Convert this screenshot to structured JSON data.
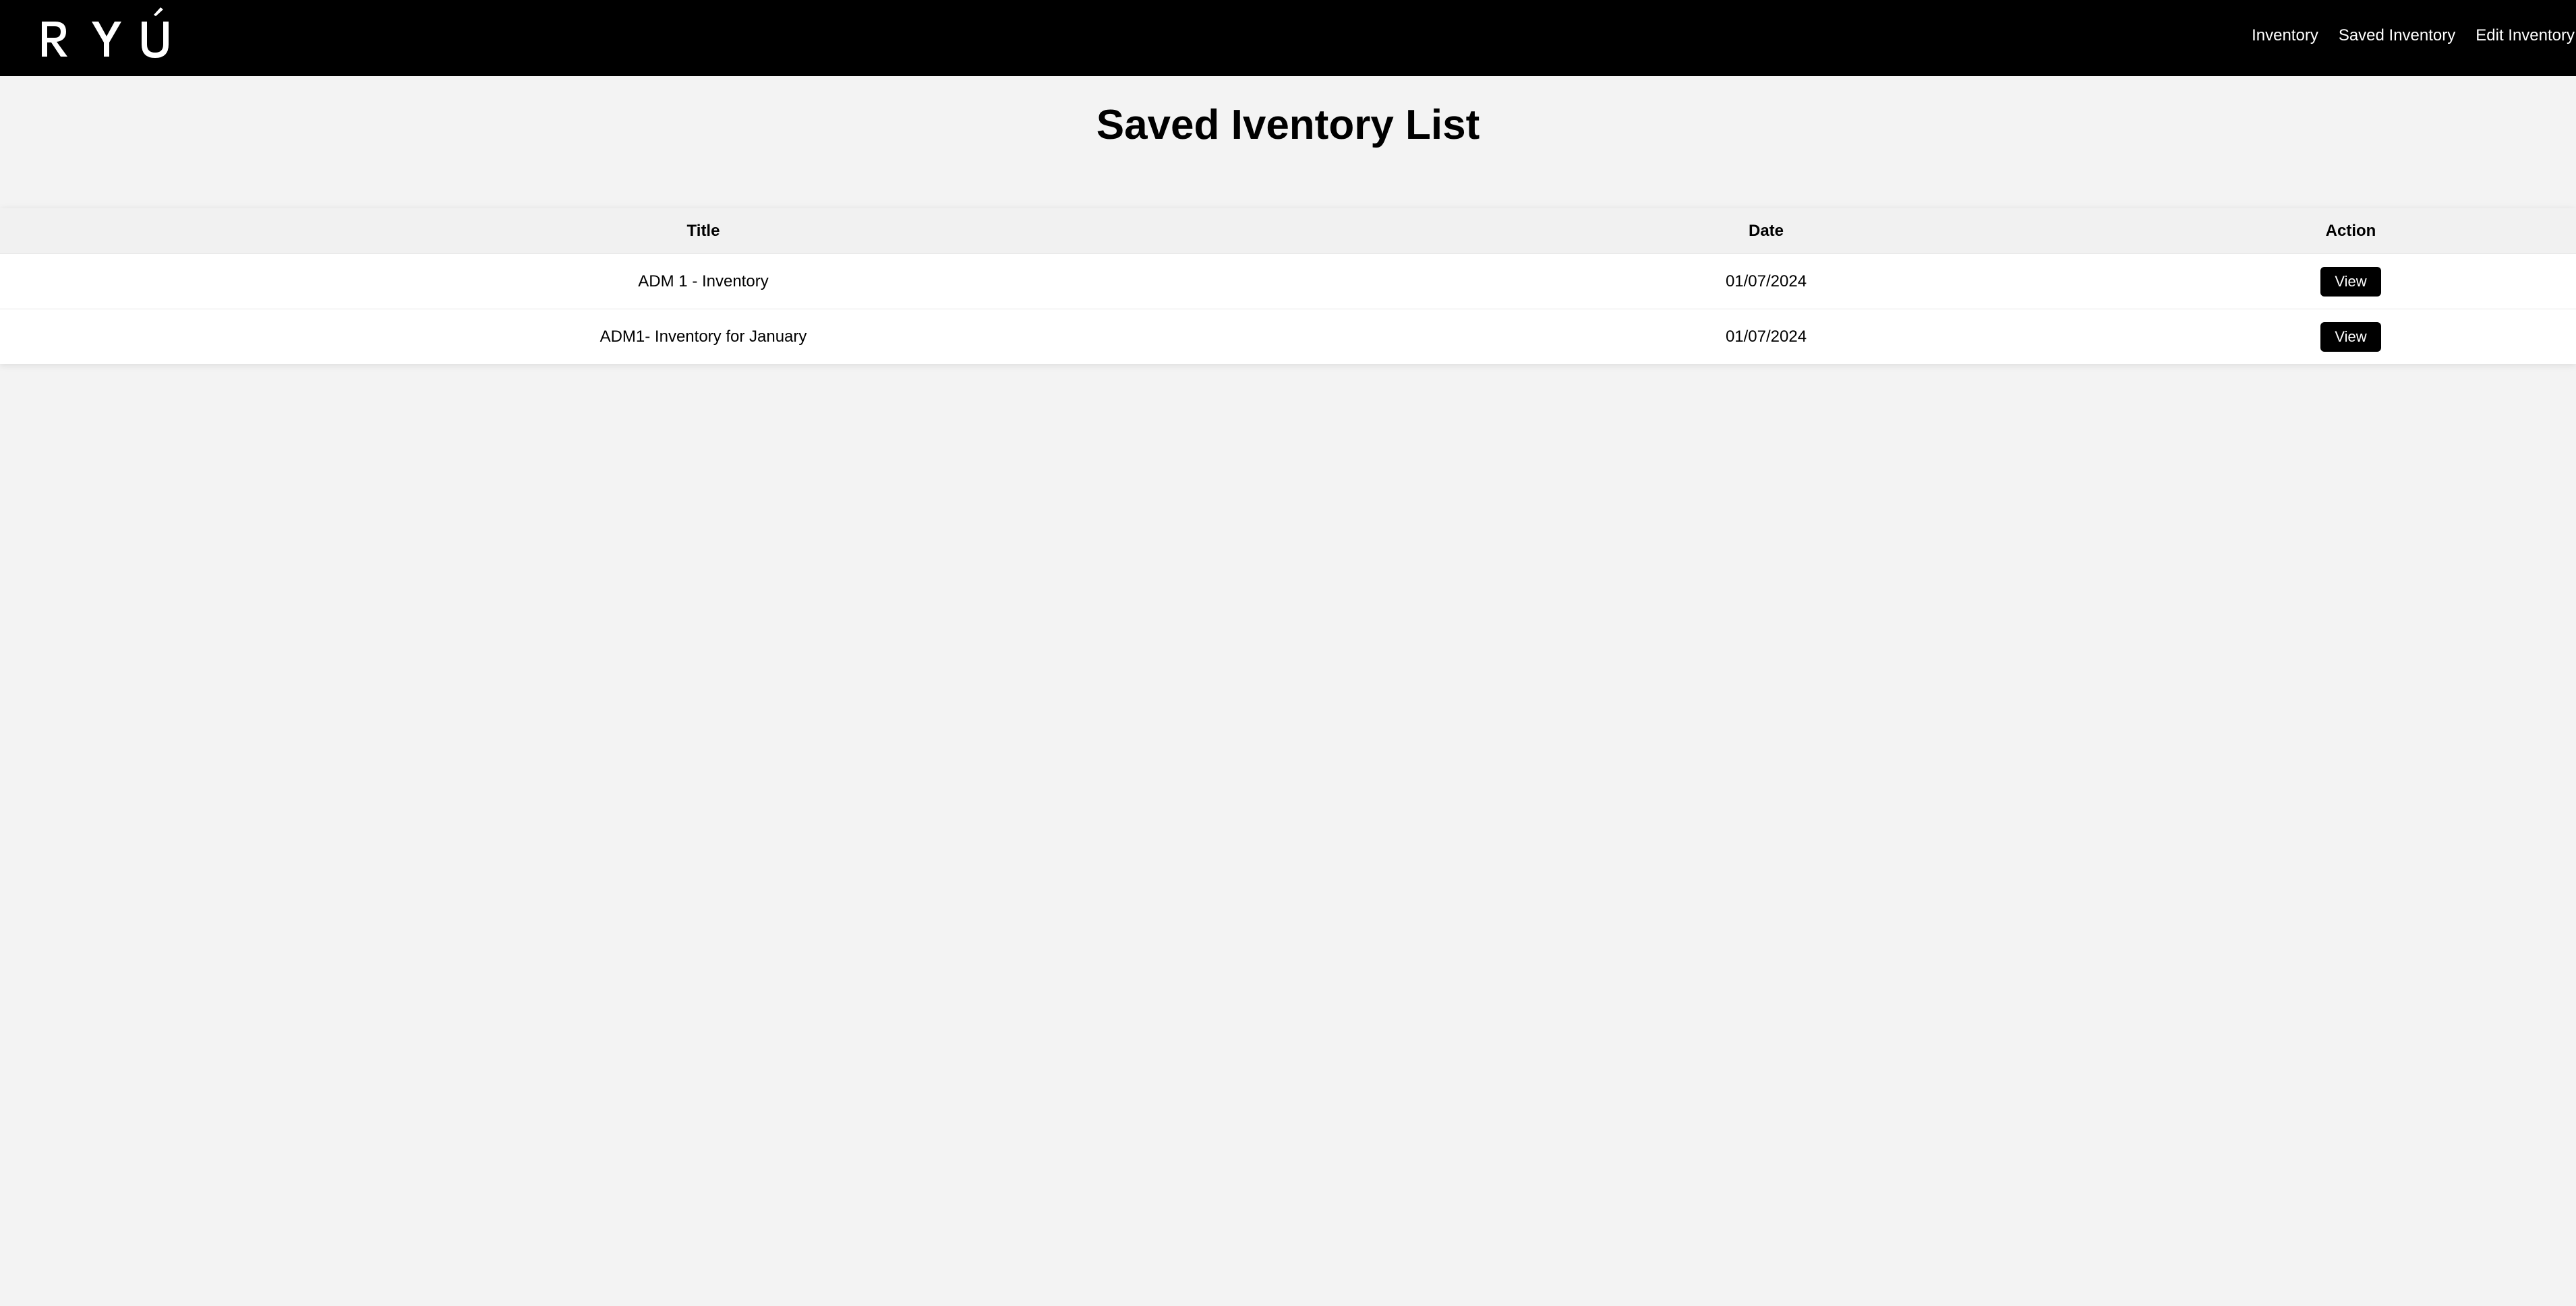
{
  "header": {
    "logo_text": "RYÚ",
    "nav": [
      {
        "label": "Inventory"
      },
      {
        "label": "Saved Inventory"
      },
      {
        "label": "Edit Inventory"
      }
    ]
  },
  "page": {
    "title": "Saved Iventory List"
  },
  "table": {
    "columns": [
      "Title",
      "Date",
      "Action"
    ],
    "rows": [
      {
        "title": "ADM 1 - Inventory",
        "date": "01/07/2024",
        "action": "View"
      },
      {
        "title": "ADM1- Inventory for January",
        "date": "01/07/2024",
        "action": "View"
      }
    ]
  },
  "colors": {
    "header_bg": "#000000",
    "page_bg": "#f3f3f3",
    "button_bg": "#000000"
  }
}
